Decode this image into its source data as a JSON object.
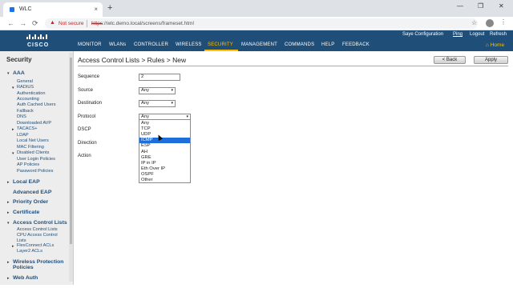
{
  "browser": {
    "tab_title": "WLC",
    "tab_close": "×",
    "new_tab": "+",
    "window_controls": [
      "—",
      "❐",
      "✕"
    ],
    "nav": [
      "←",
      "→",
      "⟳"
    ],
    "security_warning": "Not secure",
    "url_scheme": "https",
    "url_rest": "://wlc.demo.local/screens/frameset.html",
    "star": "☆",
    "menu": "⋮"
  },
  "wlc": {
    "logo": "CISCO",
    "top_links": [
      "Saye Configuration",
      "Ping",
      "Logout",
      "Refresh"
    ],
    "main_nav": [
      "MONITOR",
      "WLANs",
      "CONTROLLER",
      "WIRELESS",
      "SECURITY",
      "MANAGEMENT",
      "COMMANDS",
      "HELP",
      "FEEDBACK"
    ],
    "active_nav": "SECURITY",
    "home": "Home",
    "colors": {
      "header_bg": "#1f4e79",
      "active": "#ffc000",
      "nav_text": "#1f4e79"
    }
  },
  "sidebar": {
    "title": "Security",
    "items": [
      {
        "label": "AAA",
        "type": "h",
        "tri": "▾"
      },
      {
        "label": "General",
        "type": "s"
      },
      {
        "label": "RADIUS",
        "type": "s",
        "tri": "▾"
      },
      {
        "label": "Authentication",
        "type": "s"
      },
      {
        "label": "Accounting",
        "type": "s"
      },
      {
        "label": "Auth Cached Users",
        "type": "s"
      },
      {
        "label": "Fallback",
        "type": "s"
      },
      {
        "label": "DNS",
        "type": "s"
      },
      {
        "label": "Downloaded AVP",
        "type": "s"
      },
      {
        "label": "TACACS+",
        "type": "s",
        "tri": "▸"
      },
      {
        "label": "LDAP",
        "type": "s"
      },
      {
        "label": "Local Net Users",
        "type": "s"
      },
      {
        "label": "MAC Filtering",
        "type": "s"
      },
      {
        "label": "Disabled Clients",
        "type": "s",
        "tri": "▾"
      },
      {
        "label": "User Login Policies",
        "type": "s"
      },
      {
        "label": "AP Policies",
        "type": "s"
      },
      {
        "label": "Password Policies",
        "type": "s"
      },
      {
        "label": "Local EAP",
        "type": "h",
        "tri": "▸"
      },
      {
        "label": "Advanced EAP",
        "type": "h"
      },
      {
        "label": "Priority Order",
        "type": "h",
        "tri": "▸"
      },
      {
        "label": "Certificate",
        "type": "h",
        "tri": "▸"
      },
      {
        "label": "Access Control Lists",
        "type": "h",
        "tri": "▾"
      },
      {
        "label": "Access Control Lists",
        "type": "s"
      },
      {
        "label": "CPU Access Control",
        "type": "s"
      },
      {
        "label": "Lists",
        "type": "s"
      },
      {
        "label": "FlexConnect ACLs",
        "type": "s",
        "tri": "▸"
      },
      {
        "label": "Layer2 ACLs",
        "type": "s"
      },
      {
        "label": "Wireless Protection",
        "type": "h",
        "tri": "▸"
      },
      {
        "label": "Policies",
        "type": "h"
      },
      {
        "label": "Web Auth",
        "type": "h",
        "tri": "▸"
      }
    ]
  },
  "main": {
    "title": "Access Control Lists > Rules > New",
    "back_button": "< Back",
    "apply_button": "Apply",
    "labels": [
      "Sequence",
      "Source",
      "Destination",
      "Protocol",
      "DSCP",
      "Direction",
      "Action"
    ],
    "sequence_value": "2",
    "source_value": "Any",
    "destination_value": "Any",
    "protocol_value": "Any",
    "dropdown_arrow": "▾",
    "protocol_options": [
      "Any",
      "TCP",
      "UDP",
      "ICMP",
      "ESP",
      "AH",
      "GRE",
      "IP in IP",
      "Eth Over IP",
      "OSPF",
      "Other"
    ],
    "highlighted_option": "ICMP"
  }
}
